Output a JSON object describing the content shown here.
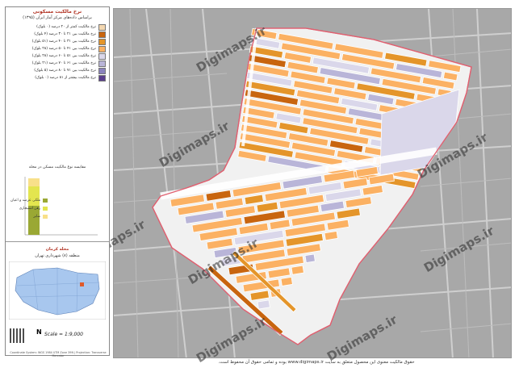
{
  "legend": {
    "title": "نرخ مالکیت مسکونی",
    "subtitle": "براساس داده‌های مرکز آمار ایران (۱۳۹۵)",
    "items": [
      {
        "label": "نرخ مالکیت کمتر از ۲۰ درصد (۰ بلوک)",
        "color": "#f3d7b0"
      },
      {
        "label": "نرخ مالکیت بین ۲۱ تا ۳۰ درصد (۴ بلوک)",
        "color": "#c8650f"
      },
      {
        "label": "نرخ مالکیت بین ۳۱ تا ۴۰ درصد (۵۱ بلوک)",
        "color": "#e4952a"
      },
      {
        "label": "نرخ مالکیت بین ۴۱ تا ۵۰ درصد (۲۸ بلوک)",
        "color": "#fbb163"
      },
      {
        "label": "نرخ مالکیت بین ۵۱ تا ۶۰ درصد (۲۸ بلوک)",
        "color": "#dad7ea"
      },
      {
        "label": "نرخ مالکیت بین ۶۱ تا ۷۰ درصد (۲۱ بلوک)",
        "color": "#b9b5d8"
      },
      {
        "label": "نرخ مالکیت بین ۷۱ تا ۸۰ درصد (۵ بلوک)",
        "color": "#8a82bd"
      },
      {
        "label": "نرخ مالکیت بیشتر از ۸۱ درصد (۰ بلوک)",
        "color": "#5a3d8c"
      }
    ],
    "bar_title": "مقایسه نوع مالکیت مسکن در محله",
    "bar_legend": [
      {
        "label": "ملکی عرصه و اعیان",
        "color": "#9aa834"
      },
      {
        "label": "رهن استیجاری",
        "color": "#e3e54f"
      },
      {
        "label": "سایر",
        "color": "#f8e08a"
      }
    ],
    "city": "محله کرمان",
    "district": "منطقه (۸) شهرداری تهران",
    "scale": "Scale = 1:9,000",
    "north": "N",
    "credit": "Coordinate System: WGS 1984 UTM Zone 39N | Projection: Transverse Mercator"
  },
  "watermark": "Digimaps.ir",
  "footer": "حقوق مالکیت معنوی این محصول متعلق به سایت www.digimaps.ir بوده و تمامی حقوق آن محفوظ است.",
  "colors": {
    "map_bg": "#a9a9a9",
    "road_light": "#e8e8e8",
    "boundary": "#e06070"
  }
}
